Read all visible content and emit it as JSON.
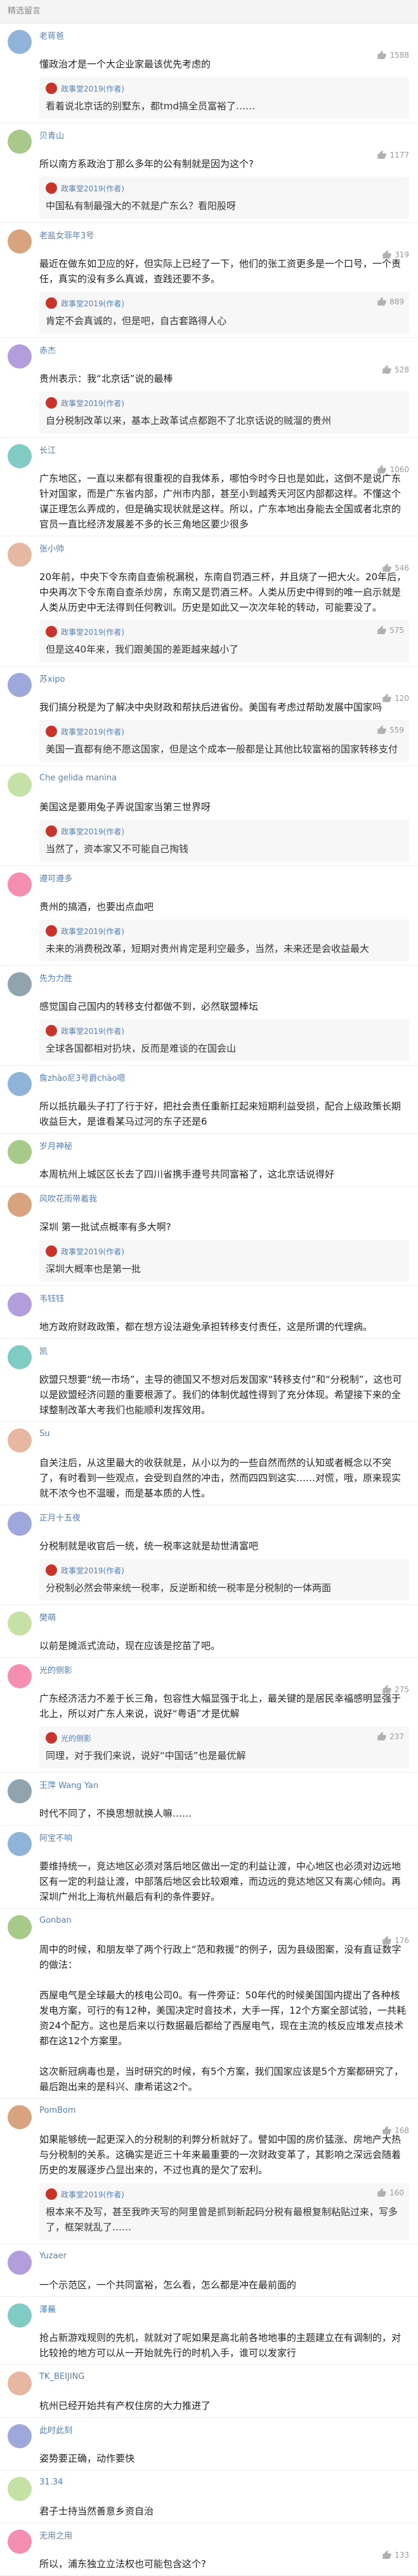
{
  "header": {
    "title": "精选留言"
  },
  "colors": {
    "link": "#557fb5",
    "time": "#aaaaaa",
    "reply_bg": "#f7f7f7",
    "author_avatar": "#c8342a"
  },
  "comments": [
    {
      "author": "老蒋爸",
      "time": "",
      "likes": "1588",
      "text": "懂政治才是一个大企业家最该优先考虑的",
      "reply": {
        "author": "政事堂2019(作者)",
        "time": "",
        "likes": "",
        "text": "看着说北京话的别墅东，都tmd搞全员富裕了……"
      }
    },
    {
      "author": "贝青山",
      "time": "",
      "likes": "1177",
      "text": "所以南方系政治丁那么多年的公有制就是因为这个?",
      "reply": {
        "author": "政事堂2019(作者)",
        "time": "",
        "likes": "",
        "text": "中国私有制最强大的不就是广东么？看阳股呀"
      }
    },
    {
      "author": "老盐女菲年3号",
      "time": "",
      "likes": "319",
      "text": "最近在做东如卫应的好，但实际上已经了一下，他们的张工资更多是一个口号，一个责任，真实的没有多么真诚，查践还要不多。",
      "reply": {
        "author": "政事堂2019(作者)",
        "time": "",
        "likes": "889",
        "text": "肯定不会真诚的，但是吧，自古套路得人心"
      }
    },
    {
      "author": "赤杰",
      "time": "",
      "likes": "528",
      "text": "贵州表示：我“北京话”说的最棒",
      "reply": {
        "author": "政事堂2019(作者)",
        "time": "",
        "likes": "",
        "text": "自分税制改革以来，基本上政革试点都跑不了北京话说的贼溜的贵州"
      }
    },
    {
      "author": "长江",
      "time": "",
      "likes": "1060",
      "text": "广东地区，一直以来都有很重视的自我体系，哪怕今时今日也是如此，这倒不是说广东针对国家，而是广东省内部，广州市内部，甚至小到越秀天河区内部都这样。不懂这个谋正理怎么弄成的，但是确实现状就是这样。所以，广东本地出身能去全国或者北京的官员一直比经济发展差不多的长三角地区要少很多",
      "reply": null
    },
    {
      "author": "张小帅",
      "time": "",
      "likes": "546",
      "text": "20年前，中央下令东南自查偷税漏税，东南自罚酒三杯，并且烧了一把大火。20年后，中央再次下令东南自查杀炒房，东南又是罚酒三杯。人类从历史中得到的唯一启示就是人类从历史中无法得到任何教训。历史是如此又一次次年轮的转动，可能要没了。",
      "reply": {
        "author": "政事堂2019(作者)",
        "time": "",
        "likes": "575",
        "text": "但是这40年来，我们跟美国的差距越来越小了"
      }
    },
    {
      "author": "苏xipo",
      "time": "",
      "likes": "120",
      "text": "我们搞分税是为了解决中央财政和帮扶后进省份。美国有考虑过帮助发展中国家吗",
      "reply": {
        "author": "政事堂2019(作者)",
        "time": "",
        "likes": "559",
        "text": "美国一直都有绝不愿这国家，但是这个成本一般都是让其他比较富裕的国家转移支付"
      }
    },
    {
      "author": "Che gelida manina",
      "time": "",
      "likes": "",
      "text": "美国这是要用兔子弄说国家当第三世界呀",
      "reply": {
        "author": "政事堂2019(作者)",
        "time": "",
        "likes": "",
        "text": "当然了，资本家又不可能自己掏钱"
      }
    },
    {
      "author": "遵可遵多",
      "time": "",
      "likes": "",
      "text": "贵州的搞酒，也要出点血吧",
      "reply": {
        "author": "政事堂2019(作者)",
        "time": "",
        "likes": "",
        "text": "未来的消费税改革，短期对贵州肯定是利空最多，当然，未来还是会收益最大"
      }
    },
    {
      "author": "先为力胜",
      "time": "",
      "likes": "",
      "text": "感觉国自己国内的转移支付都做不到，必然联盟棒坛",
      "reply": {
        "author": "政事堂2019(作者)",
        "time": "",
        "likes": "",
        "text": "全球各国都相对扔块，反而是难谈的在国会山"
      }
    },
    {
      "author": "詹zhào尼3号爵chào嗯",
      "time": "",
      "likes": "",
      "text": "所以抵抗最头子打了行于好，把社会责任重新扛起来短期利益受损，配合上级政策长期收益巨大，是谁看某马过河的东子还是6",
      "reply": null
    },
    {
      "author": "岁月神秘",
      "time": "",
      "likes": "",
      "text": "本周杭州上城区区长去了四川省携手遵号共同富裕了，这北京话说得好",
      "reply": null
    },
    {
      "author": "风吹花雨带着我",
      "time": "",
      "likes": "",
      "text": "深圳 第一批试点概率有多大啊?",
      "reply": {
        "author": "政事堂2019(作者)",
        "time": "",
        "likes": "",
        "text": "深圳大概率也是第一批"
      }
    },
    {
      "author": "韦钰钰",
      "time": "",
      "likes": "",
      "text": "地方政府财政政策，都在想方设法避免承担转移支付责任，这是所谓的代理病。",
      "reply": null
    },
    {
      "author": "凯",
      "time": "",
      "likes": "",
      "text": "欧盟只想要“统一市场”，主导的德国又不想对后发国家“转移支付”和“分税制”，这也可以是欧盟经济问题的重要根源了。我们的体制优越性得到了充分体现。希望接下来的全球整制改革大考我们也能顺利发挥效用。",
      "reply": null
    },
    {
      "author": "Su",
      "time": "",
      "likes": "",
      "text": "自关注后，从这里最大的收获就是，从小以为的一些自然而然的认知或者概念以不突了，有时看到一些观点，会受到自然的冲击，然而四四到这实……对慌，哦，原来现实就不浓今也不温暖，而是基本质的人性。",
      "reply": null
    },
    {
      "author": "正月十五夜",
      "time": "",
      "likes": "",
      "text": "分税制就是收官后一统，统一税率这就是劫世清富吧",
      "reply": {
        "author": "政事堂2019(作者)",
        "time": "",
        "likes": "",
        "text": "分税制必然会带来统一税率，反逆断和统一税率是分税制的一体两面"
      }
    },
    {
      "author": "樊萌",
      "time": "",
      "likes": "",
      "text": "以前是摊派式流动，现在应该是挖苗了吧。",
      "reply": null
    },
    {
      "author": "光的侧影",
      "time": "",
      "likes": "275",
      "text": "广东经济活力不差于长三角，包容性大幅显强于北上，最关键的是居民幸福感明显强于北上，所以对广东人来说，说好“粤语”才是优解",
      "reply": {
        "author": "光的侧影",
        "time": "",
        "likes": "237",
        "text": "同理，对于我们来说，说好“中国话”也是最优解"
      }
    },
    {
      "author": "王萍 Wang Yan",
      "time": "",
      "likes": "",
      "text": "时代不同了，不换思想就换人嘛……",
      "reply": null
    },
    {
      "author": "阿宝不响",
      "time": "",
      "likes": "",
      "text": "要维持统一，竞达地区必须对落后地区做出一定的利益让渡，中心地区也必须对边远地区有一定的利益让渡，中部落后地区会比较艰难，而边远的竞达地区又有离心倾向。再深圳广州北上海杭州最后有利的条件要好。",
      "reply": null
    },
    {
      "author": "Gonban",
      "time": "",
      "likes": "176",
      "text": "周中的时候，和朋友举了两个行政上“范和救援”的例子，因为县级图案，没有直证数字的做法：\n\n西屋电气是全球最大的核电公司0。有一件旁证：50年代的时候美国国内提出了各种核发电方案，可行的有12种，美国决定时音技术，大手一挥，12个方案全部试验，一共耗资24个配方。这也是后来以行数据最后都给了西屋电气，现在主流的核反应堆发点技术都在这12个方案里。\n\n这次新冠病毒也是，当时研究的时候，有5个方案，我们国家应该是5个方案都研究了，最后跑出来的是科兴、康希诺这2个。",
      "reply": null
    },
    {
      "author": "PomBom",
      "time": "",
      "likes": "168",
      "text": "如果能够统一起更深入的分税制的利弊分析就好了。譬如中国的房价猛涨、房地产大热与分税制的关系。这确实是近三十年来最重要的一次财政变革了，其影响之深远会随着历史的发展逐步凸显出来的，不过也真的是欠了宏利。",
      "reply": {
        "author": "政事堂2019(作者)",
        "time": "",
        "likes": "160",
        "text": "根本来不及写，甚至我昨天写的阿里曾是抓到新起码分税有最根复制粘贴过来，写多了，框架就乱了……"
      }
    },
    {
      "author": "Yuzaer",
      "time": "",
      "likes": "",
      "text": "一个示范区，一个共同富裕，怎么看，怎么都是冲在最前面的",
      "reply": null
    },
    {
      "author": "澤蕪",
      "time": "",
      "likes": "",
      "text": "抢占新游戏规则的先机，就就对了呢如果是高北前各地地事的主题建立在有调制的，对比较抢的地方可以从一开始就先行的时机入手，谁可以发家行",
      "reply": null
    },
    {
      "author": "TK_BEIJING",
      "time": "",
      "likes": "",
      "text": "杭州已经开始共有产权住房的大力推进了",
      "reply": null
    },
    {
      "author": "此时此刻",
      "time": "",
      "likes": "",
      "text": "姿势要正确，动作要快",
      "reply": null
    },
    {
      "author": "31.34",
      "time": "",
      "likes": "",
      "text": "君子士持当然善意乡资自治",
      "reply": null
    },
    {
      "author": "无用之用",
      "time": "",
      "likes": "133",
      "text": "所以，浦东独立立法权也可能包含这个?",
      "reply": null
    }
  ]
}
